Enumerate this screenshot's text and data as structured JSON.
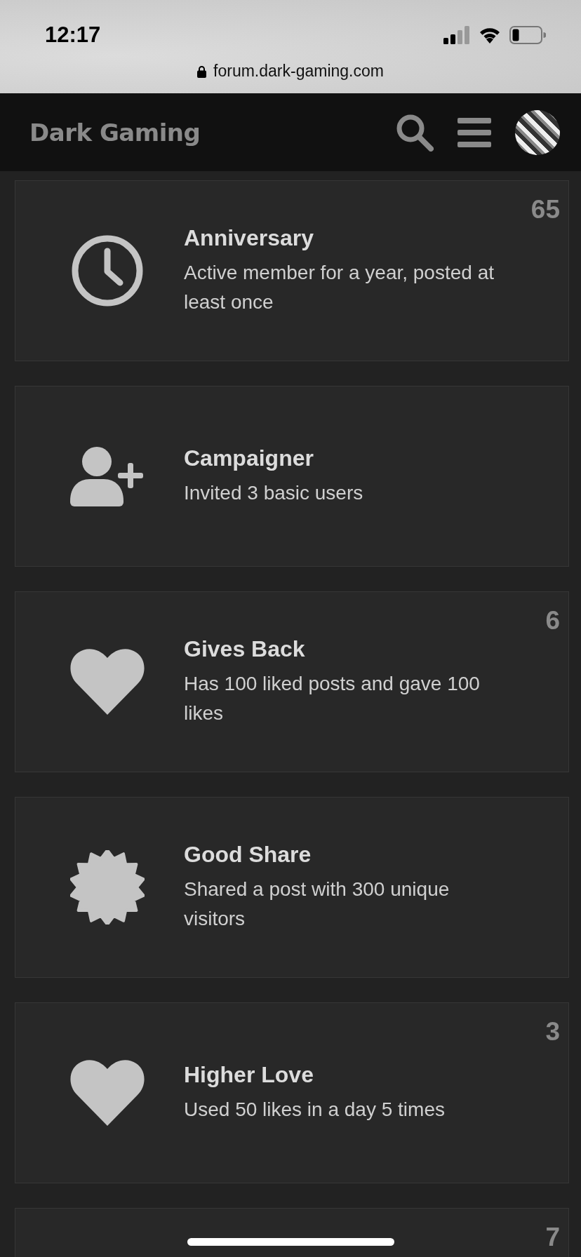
{
  "status_bar": {
    "time": "12:17"
  },
  "address_bar": {
    "url": "forum.dark-gaming.com"
  },
  "header": {
    "site_title": "Dark Gaming"
  },
  "badges": [
    {
      "kind": "clock",
      "count": "65",
      "title": "Anniversary",
      "description": "Active member for a year, posted at least once"
    },
    {
      "kind": "user-plus",
      "title": "Campaigner",
      "description": "Invited 3 basic users"
    },
    {
      "kind": "heart",
      "count": "6",
      "title": "Gives Back",
      "description": "Has 100 liked posts and gave 100 likes"
    },
    {
      "kind": "starburst",
      "title": "Good Share",
      "description": "Shared a post with 300 unique visitors"
    },
    {
      "kind": "heart",
      "count": "3",
      "title": "Higher Love",
      "description": "Used 50 likes in a day 5 times"
    },
    {
      "count": "7"
    }
  ]
}
